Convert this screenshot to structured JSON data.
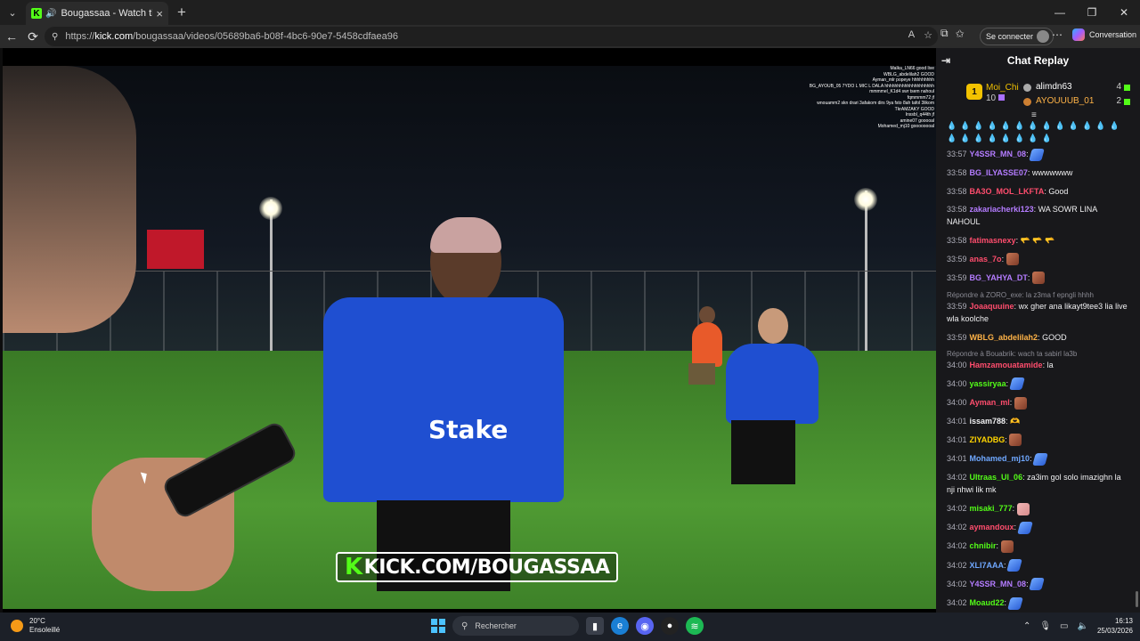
{
  "browser": {
    "tab": {
      "title": "Bougassaa - Watch the VOD o"
    },
    "url": {
      "prefix": "https://",
      "domain": "kick.com",
      "path": "/bougassaa/videos/05689ba6-b08f-4bc6-90e7-5458cdfaea96"
    },
    "signin_label": "Se connecter",
    "copilot_label": "Conversation"
  },
  "video": {
    "watermark": "KICK.COM/BOUGASSAA",
    "overlay_chat": [
      "Malka_LN66  good live",
      "WBLG_abdelilah2  GOOD",
      "Ayman_mlr  popeye hhhhhhhhh",
      "BG_AYOUB_05  7YDO L MIC L DALA hhhhhhhhhhhhhhhhhhhh",
      "mmmmel_K1d4  swr tsem nahoul",
      "fqmmmm72  jf",
      "wnouamm2  skn drari 3afakom dirs 9ya fsto 8ah tafol 3likom",
      "TkrAMZAKY  GOOD",
      "Inssbl_q44th  jf",
      "amine07  gooooal",
      "Mohamed_mj10  goooooooal"
    ]
  },
  "chat": {
    "header": "Chat Replay",
    "leaderboard": {
      "first": {
        "rank": "1",
        "name": "Moi_Chi",
        "count": "10"
      },
      "others": [
        {
          "name": "alimdn63",
          "count": "4"
        },
        {
          "name": "AYOUUUB_01",
          "count": "2"
        }
      ]
    },
    "messages": [
      {
        "time": "33:57",
        "user": "Y4SSR_MN_08",
        "color": "#b47cff",
        "text": "",
        "emote": "blue"
      },
      {
        "time": "33:58",
        "user": "BG_ILYASSE07",
        "color": "#b47cff",
        "text": "wwwwwww",
        "emote": ""
      },
      {
        "time": "33:58",
        "user": "BA3O_MOL_LKFTA",
        "color": "#ff4d6d",
        "text": "Good",
        "emote": ""
      },
      {
        "time": "33:58",
        "user": "zakariacherki123",
        "color": "#b47cff",
        "text": "WA SOWR LINA NAHOUL",
        "emote": ""
      },
      {
        "time": "33:58",
        "user": "fatimasnexy",
        "color": "#ff4d6d",
        "text": "🫳 🫳 🫳",
        "emote": ""
      },
      {
        "time": "33:59",
        "user": "anas_7o",
        "color": "#ff4d6d",
        "text": "",
        "emote": "photo"
      },
      {
        "time": "33:59",
        "user": "BG_YAHYA_DT",
        "color": "#b47cff",
        "text": "",
        "emote": "photo"
      },
      {
        "reply": "Répondre à ZORO_exe: la z3ma f epngli hhhh",
        "time": "33:59",
        "user": "Joaaquuine",
        "color": "#ff4d6d",
        "text": "wx gher ana likayt9tee3 lia live wla koolche",
        "emote": ""
      },
      {
        "time": "33:59",
        "user": "WBLG_abdelilah2",
        "color": "#ffb347",
        "text": "GOOD",
        "emote": ""
      },
      {
        "reply": "Répondre à Bouabrik: wach ta sabirl la3b",
        "time": "34:00",
        "user": "Hamzamouatamide",
        "color": "#ff4d6d",
        "text": "la",
        "emote": ""
      },
      {
        "time": "34:00",
        "user": "yassiryaa",
        "color": "#53fc18",
        "text": "",
        "emote": "blue"
      },
      {
        "time": "34:00",
        "user": "Ayman_ml",
        "color": "#ff4d6d",
        "text": "",
        "emote": "photo"
      },
      {
        "time": "34:01",
        "user": "issam788",
        "color": "#efeff1",
        "text": "🫶",
        "emote": ""
      },
      {
        "time": "34:01",
        "user": "ZIYADBG",
        "color": "#ffd400",
        "text": "",
        "emote": "photo"
      },
      {
        "time": "34:01",
        "user": "Mohamed_mj10",
        "color": "#6fa8ff",
        "text": "",
        "emote": "blue"
      },
      {
        "time": "34:02",
        "user": "Ultraas_Ul_06",
        "color": "#53fc18",
        "text": "za3im gol solo imazighn la nji nhwi lik mk",
        "emote": ""
      },
      {
        "time": "34:02",
        "user": "misaki_777",
        "color": "#53fc18",
        "text": "",
        "emote": "pink"
      },
      {
        "time": "34:02",
        "user": "aymandoux",
        "color": "#ff4d6d",
        "text": "",
        "emote": "blue"
      },
      {
        "time": "34:02",
        "user": "chnibir",
        "color": "#53fc18",
        "text": "",
        "emote": "photo"
      },
      {
        "time": "34:02",
        "user": "XLI7AAA",
        "color": "#6fa8ff",
        "text": "",
        "emote": "blue"
      },
      {
        "time": "34:02",
        "user": "Y4SSR_MN_08",
        "color": "#b47cff",
        "text": "",
        "emote": "blue"
      },
      {
        "time": "34:02",
        "user": "Moaud22",
        "color": "#53fc18",
        "text": "",
        "emote": "blue"
      }
    ]
  },
  "taskbar": {
    "weather_temp": "20°C",
    "weather_desc": "Ensoleillé",
    "search_placeholder": "Rechercher",
    "time": "16:13",
    "date": "25/03/2026"
  }
}
